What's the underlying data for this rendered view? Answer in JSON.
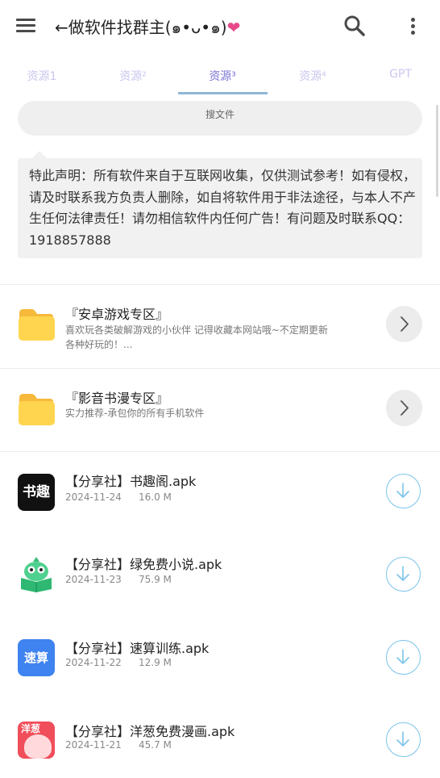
{
  "app": {
    "title": "←做软件找群主(๑•ᴗ•๑)",
    "title_heart": "❤"
  },
  "icons": {
    "menu": "menu-icon",
    "search": "search-icon",
    "more": "more-vert-icon",
    "folder": "folder-icon",
    "chevron": "chevron-right-icon",
    "download": "download-icon"
  },
  "tabs": [
    {
      "label": "资源1"
    },
    {
      "label": "资源²"
    },
    {
      "label": "资源³"
    },
    {
      "label": "资源⁴"
    },
    {
      "label": "GPT"
    }
  ],
  "active_tab": "资源³",
  "search": {
    "placeholder": "搜文件"
  },
  "notice": {
    "text": "特此声明：所有软件来自于互联网收集，仅供测试参考！如有侵权，请及时联系我方负责人删除，如自将软件用于非法途径，与本人不产生任何法律责任！请勿相信软件内任何广告！有问题及时联系QQ：1918857888"
  },
  "folders": [
    {
      "title": "『安卓游戏专区』",
      "desc": "喜欢玩各类破解游戏的小伙伴 记得收藏本网站哦~不定期更新各种好玩的！..."
    },
    {
      "title": "『影音书漫专区』",
      "desc": "实力推荐-承包你的所有手机软件"
    }
  ],
  "files": [
    {
      "name": "【分享社】书趣阁.apk",
      "date": "2024-11-24",
      "size": "16.0 M",
      "icon_text": "书趣"
    },
    {
      "name": "【分享社】绿免费小说.apk",
      "date": "2024-11-23",
      "size": "75.9 M",
      "icon_text": ""
    },
    {
      "name": "【分享社】速算训练.apk",
      "date": "2024-11-22",
      "size": "12.9 M",
      "icon_text": "速算"
    },
    {
      "name": "【分享社】洋葱免费漫画.apk",
      "date": "2024-11-21",
      "size": "45.7 M",
      "icon_text": "洋葱"
    }
  ],
  "colors": {
    "accent_tab": "#7b74d6",
    "inactive_tab": "#c9c6ee",
    "tab_underline": "#90b7d9",
    "download_ring": "#7cc4ea",
    "folder_yellow": "#ffd54f",
    "heart": "#e8488a"
  }
}
